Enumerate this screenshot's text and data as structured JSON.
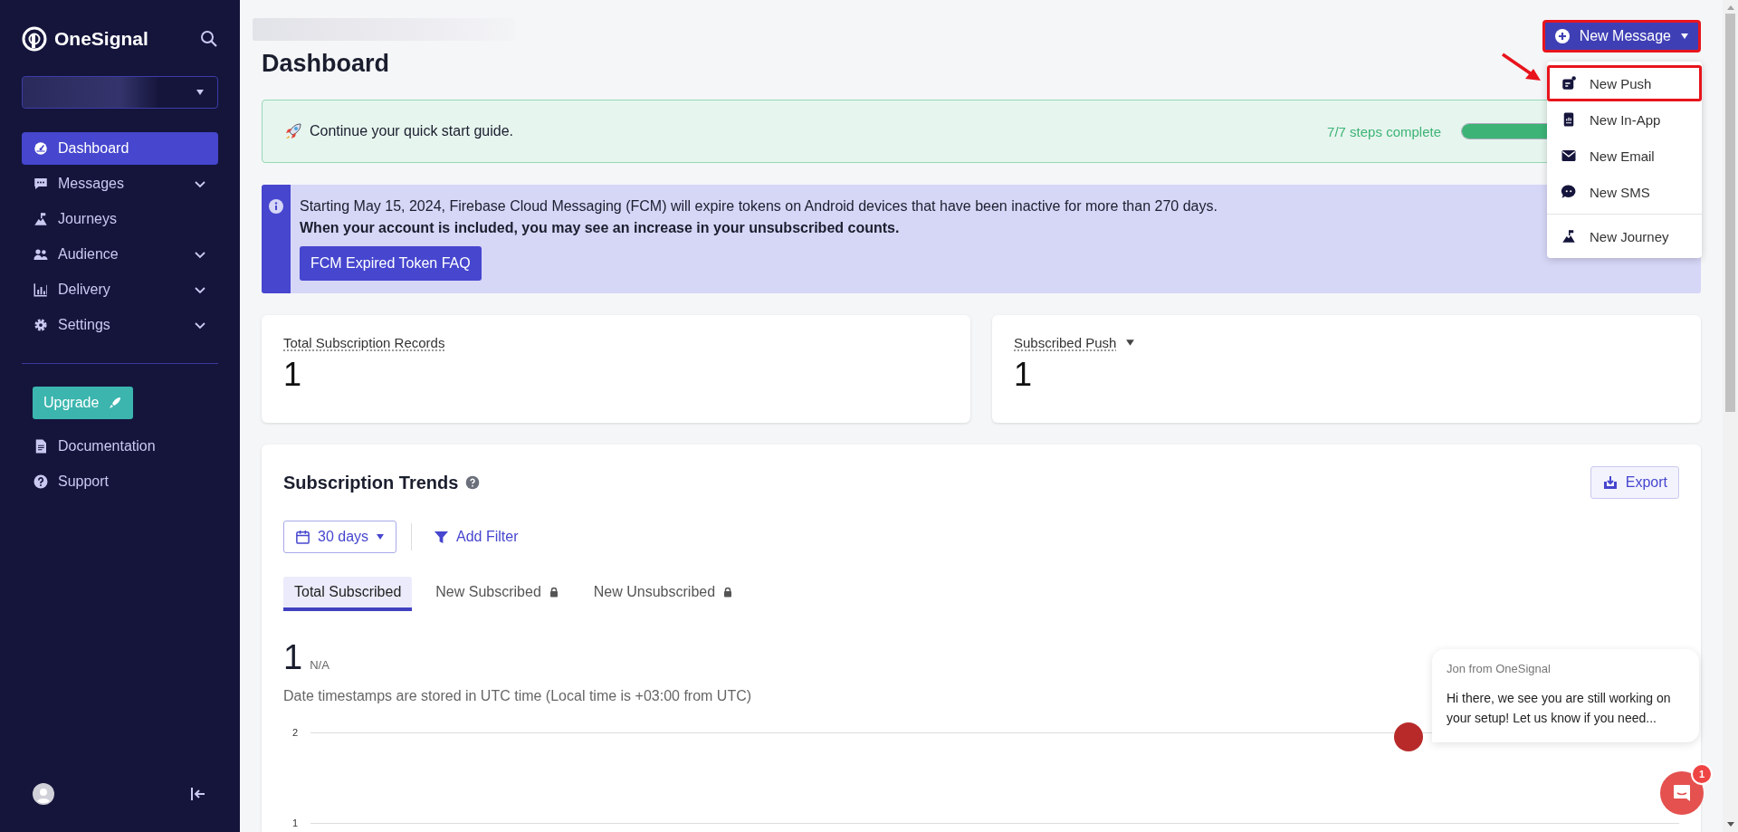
{
  "sidebar": {
    "brand": "OneSignal",
    "items": [
      {
        "label": "Dashboard",
        "kind": "gauge",
        "selected": true,
        "expandable": false
      },
      {
        "label": "Messages",
        "kind": "chat",
        "selected": false,
        "expandable": true
      },
      {
        "label": "Journeys",
        "kind": "flag",
        "selected": false,
        "expandable": false
      },
      {
        "label": "Audience",
        "kind": "people",
        "selected": false,
        "expandable": true
      },
      {
        "label": "Delivery",
        "kind": "bars",
        "selected": false,
        "expandable": true
      },
      {
        "label": "Settings",
        "kind": "gear",
        "selected": false,
        "expandable": true
      }
    ],
    "upgrade_button": "Upgrade",
    "links": [
      {
        "label": "Documentation",
        "kind": "doc"
      },
      {
        "label": "Support",
        "kind": "help"
      }
    ]
  },
  "page": {
    "title": "Dashboard"
  },
  "new_message": {
    "label": "New Message",
    "highlighted": true
  },
  "message_menu": [
    {
      "label": "New Push",
      "kind": "push",
      "highlighted": true,
      "divider_before": false
    },
    {
      "label": "New In-App",
      "kind": "inapp",
      "highlighted": false,
      "divider_before": false
    },
    {
      "label": "New Email",
      "kind": "mail",
      "highlighted": false,
      "divider_before": false
    },
    {
      "label": "New SMS",
      "kind": "sms",
      "highlighted": false,
      "divider_before": false
    },
    {
      "label": "New Journey",
      "kind": "flag",
      "highlighted": false,
      "divider_before": true
    }
  ],
  "quick_start": {
    "text": "Continue your quick start guide.",
    "steps": "7/7 steps complete",
    "level": 1
  },
  "notice": {
    "text": "Starting May 15, 2024, Firebase Cloud Messaging (FCM) will expire tokens on Android devices that have been inactive for more than 270 days.",
    "emphasis": "When your account is included, you may see an increase in your unsubscribed counts.",
    "button": "FCM Expired Token FAQ"
  },
  "stats": [
    {
      "label": "Total Subscription Records",
      "value": "1",
      "dropdown": false
    },
    {
      "label": "Subscribed Push",
      "value": "1",
      "dropdown": true
    }
  ],
  "trends": {
    "title": "Subscription Trends",
    "export": "Export",
    "range": "30 days",
    "filter": "Add Filter",
    "tabs": [
      {
        "label": "Total Subscribed",
        "selected": true,
        "locked": false
      },
      {
        "label": "New Subscribed",
        "selected": false,
        "locked": true
      },
      {
        "label": "New Unsubscribed",
        "selected": false,
        "locked": true
      }
    ],
    "value": "1",
    "change": "N/A",
    "note": "Date timestamps are stored in UTC time (Local time is +03:00 from UTC)",
    "y_labels": [
      "2",
      "1"
    ]
  },
  "chat": {
    "sender": "Jon from OneSignal",
    "message": "Hi there, we see you are still working on your setup! Let us know if you need...",
    "badge": "1"
  }
}
